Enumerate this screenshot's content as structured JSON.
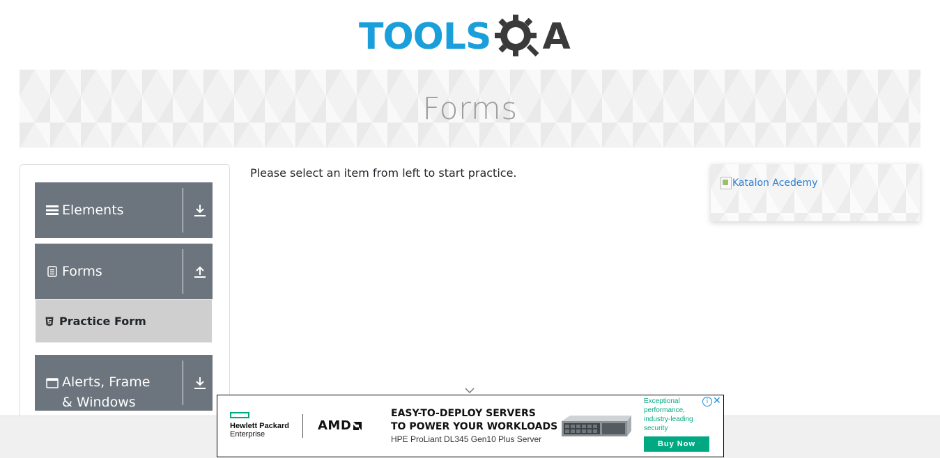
{
  "header": {
    "logo_left": "TOOLS",
    "logo_right": "A",
    "colors": {
      "tools": "#1a9fdb",
      "qa": "#3a3a3a"
    }
  },
  "banner": {
    "title": "Forms"
  },
  "sidebar": {
    "groups": [
      {
        "label": "Elements",
        "icon": "menu-icon",
        "arrow": "download-arrow-icon",
        "expanded": false
      },
      {
        "label": "Forms",
        "icon": "document-icon",
        "arrow": "upload-arrow-icon",
        "expanded": true
      },
      {
        "label": "Alerts, Frame & Windows",
        "icon": "window-icon",
        "arrow": "download-arrow-icon",
        "expanded": false
      }
    ],
    "forms_items": [
      {
        "label": "Practice Form",
        "icon": "html5-icon"
      }
    ]
  },
  "main": {
    "message": "Please select an item from left to start practice."
  },
  "side_ad": {
    "alt_text": "Katalon Acedemy"
  },
  "ad": {
    "brand_line1": "Hewlett Packard",
    "brand_line2": "Enterprise",
    "partner": "AMD",
    "headline_line1": "EASY-TO-DEPLOY SERVERS",
    "headline_line2": "TO POWER YOUR WORKLOADS",
    "subline": "HPE ProLiant DL345 Gen10 Plus Server",
    "blurb": "Exceptional performance, industry-leading security",
    "cta": "Buy Now",
    "info_glyph": "i",
    "close_glyph": "✕",
    "accent": "#01a982"
  },
  "colors": {
    "sidebar_header": "#6c757d",
    "menu_item_active": "#cfcfcf",
    "link": "#2a7fd4"
  }
}
